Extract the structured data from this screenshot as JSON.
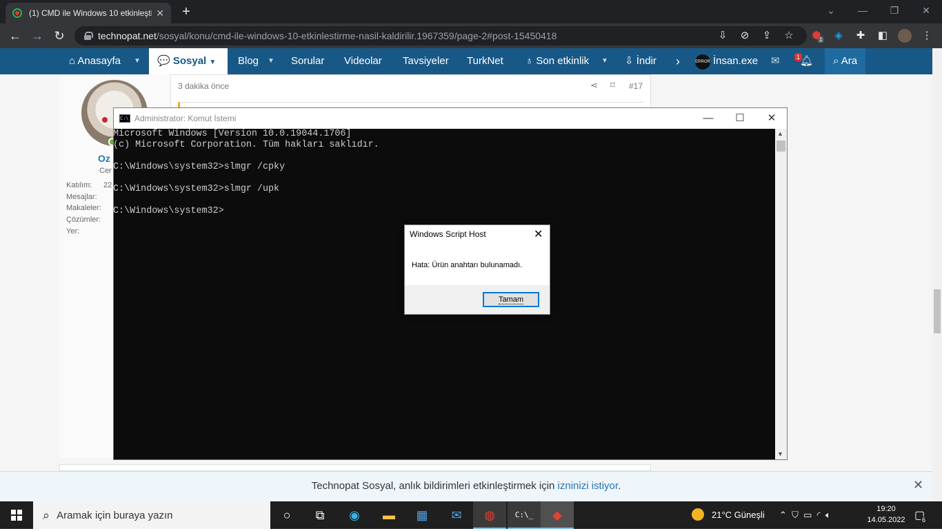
{
  "browser": {
    "tab_title": "(1) CMD ile Windows 10 etkinleşti",
    "url_host": "technopat.net",
    "url_path": "/sosyal/konu/cmd-ile-windows-10-etkinlestirme-nasil-kaldirilir.1967359/page-2#post-15450418",
    "extension_badge": "1"
  },
  "site_nav": {
    "items": [
      {
        "label": "Anasayfa"
      },
      {
        "label": "Sosyal"
      },
      {
        "label": "Blog"
      },
      {
        "label": "Sorular"
      },
      {
        "label": "Videolar"
      },
      {
        "label": "Tavsiyeler"
      },
      {
        "label": "TurkNet"
      },
      {
        "label": "Son etkinlik"
      },
      {
        "label": "İndir"
      }
    ],
    "user_name": "İnsan.exe",
    "user_badge": "ERROR",
    "alert_count": "1",
    "search_label": "Ara"
  },
  "post": {
    "time": "3 dakika önce",
    "number": "#17",
    "username_partial": "Oz",
    "role_partial": "Cer",
    "joined_partial": "22",
    "labels": [
      "Katılım:",
      "Mesajlar:",
      "Makaleler:",
      "Çözümler:",
      "Yer:"
    ]
  },
  "cmd": {
    "title": "Administrator: Komut İstemi",
    "lines": "Microsoft Windows [Version 10.0.19044.1706]\n(c) Microsoft Corporation. Tüm hakları saklıdır.\n\nC:\\Windows\\system32>slmgr /cpky\n\nC:\\Windows\\system32>slmgr /upk\n\nC:\\Windows\\system32>"
  },
  "dialog": {
    "title": "Windows Script Host",
    "message": "Hata: Ürün anahtarı bulunamadı.",
    "ok_label": "Tamam"
  },
  "notification": {
    "text_before": "Technopat Sosyal, anlık bildirimleri etkinleştirmek için ",
    "link_text": "izninizi istiyor",
    "text_after": "."
  },
  "taskbar": {
    "search_placeholder": "Aramak için buraya yazın",
    "weather": "21°C  Güneşli",
    "time": "19:20",
    "date": "14.05.2022",
    "notification_count": "6"
  }
}
